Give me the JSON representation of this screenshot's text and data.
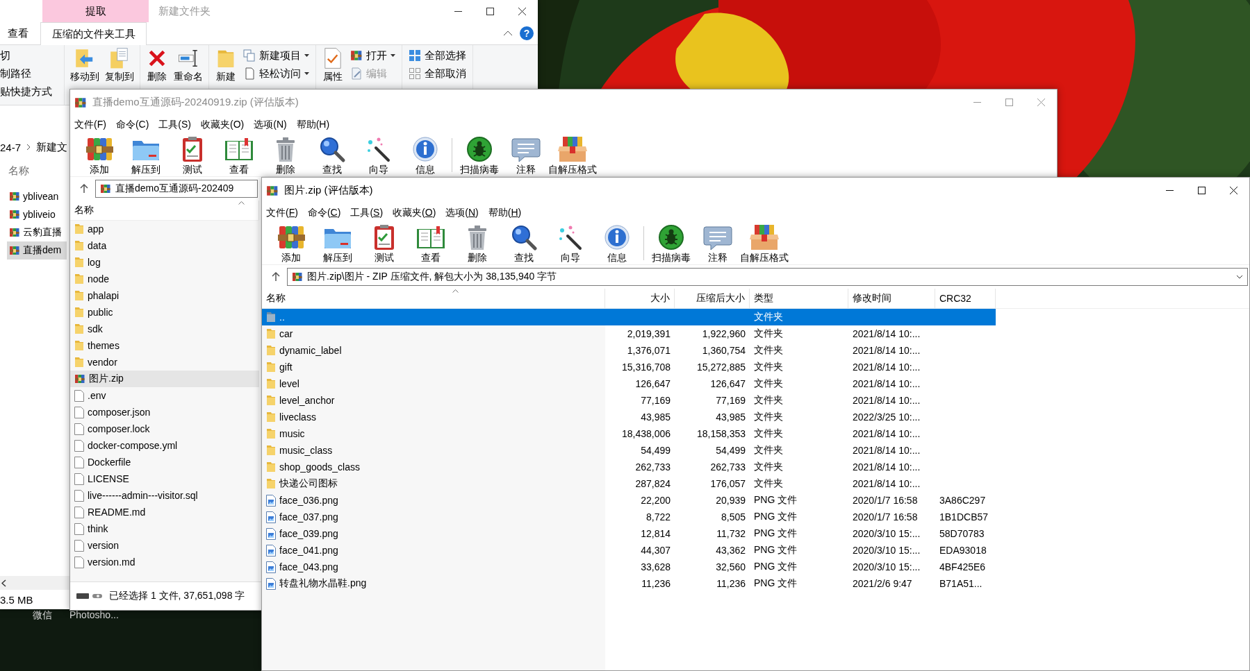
{
  "explorer": {
    "contextual_tab": "提取",
    "title": "新建文件夹",
    "tabs": [
      {
        "label": "查看",
        "selected": false
      },
      {
        "label": "压缩的文件夹工具",
        "selected": true
      }
    ],
    "help": "?",
    "ribbon_groups": [
      {
        "items": [
          {
            "kind": "text",
            "label": "切"
          },
          {
            "kind": "text",
            "label": "制路径"
          },
          {
            "kind": "text",
            "label": "贴快捷方式"
          }
        ]
      },
      {
        "items": [
          {
            "kind": "large",
            "label": "移动到"
          },
          {
            "kind": "large",
            "label": "复制到"
          }
        ]
      },
      {
        "items": [
          {
            "kind": "large",
            "label": "删除"
          },
          {
            "kind": "large",
            "label": "重命名"
          }
        ]
      },
      {
        "items": [
          {
            "kind": "large",
            "label": "新建"
          },
          {
            "kind": "small",
            "label": "新建项目",
            "dropdown": true,
            "disabled": false
          },
          {
            "kind": "small",
            "label": "轻松访问",
            "dropdown": true,
            "disabled": false
          }
        ]
      },
      {
        "items": [
          {
            "kind": "large",
            "label": "属性"
          },
          {
            "kind": "small",
            "label": "打开",
            "dropdown": true,
            "disabled": false
          },
          {
            "kind": "small",
            "label": "编辑",
            "dropdown": false,
            "disabled": true
          }
        ]
      },
      {
        "items": [
          {
            "kind": "small",
            "label": "全部选择",
            "dropdown": false,
            "disabled": false
          },
          {
            "kind": "small",
            "label": "全部取消",
            "dropdown": false,
            "disabled": false
          }
        ]
      }
    ],
    "breadcrumb": [
      "24-7",
      "新建文"
    ],
    "column": "名称",
    "items": [
      {
        "name": "yblivean",
        "selected": false
      },
      {
        "name": "ybliveio",
        "selected": false
      },
      {
        "name": "云豹直播",
        "selected": false
      },
      {
        "name": "直播dem",
        "selected": true
      }
    ],
    "status": "3.5 MB"
  },
  "desktop_labels": [
    "微信",
    "Photosho..."
  ],
  "archive_windows": [
    {
      "title": "直播demo互通源码-20240919.zip (评估版本)",
      "active": false,
      "menu": [
        "文件(F)",
        "命令(C)",
        "工具(S)",
        "收藏夹(O)",
        "选项(N)",
        "帮助(H)"
      ],
      "toolbar": [
        "添加",
        "解压到",
        "测试",
        "查看",
        "删除",
        "查找",
        "向导",
        "信息",
        "扫描病毒",
        "注释",
        "自解压格式"
      ],
      "address": "直播demo互通源码-202409",
      "columns": [
        "名称"
      ],
      "rows": [
        {
          "kind": "folder",
          "name": "app",
          "selected": false
        },
        {
          "kind": "folder",
          "name": "data",
          "selected": false
        },
        {
          "kind": "folder",
          "name": "log",
          "selected": false
        },
        {
          "kind": "folder",
          "name": "node",
          "selected": false
        },
        {
          "kind": "folder",
          "name": "phalapi",
          "selected": false
        },
        {
          "kind": "folder",
          "name": "public",
          "selected": false
        },
        {
          "kind": "folder",
          "name": "sdk",
          "selected": false
        },
        {
          "kind": "folder",
          "name": "themes",
          "selected": false
        },
        {
          "kind": "folder",
          "name": "vendor",
          "selected": false
        },
        {
          "kind": "zip",
          "name": "图片.zip",
          "selected": true
        },
        {
          "kind": "file",
          "name": ".env",
          "selected": false
        },
        {
          "kind": "file",
          "name": "composer.json",
          "selected": false
        },
        {
          "kind": "file",
          "name": "composer.lock",
          "selected": false
        },
        {
          "kind": "file",
          "name": "docker-compose.yml",
          "selected": false
        },
        {
          "kind": "file",
          "name": "Dockerfile",
          "selected": false
        },
        {
          "kind": "file",
          "name": "LICENSE",
          "selected": false
        },
        {
          "kind": "file",
          "name": "live------admin---visitor.sql",
          "selected": false
        },
        {
          "kind": "file",
          "name": "README.md",
          "selected": false
        },
        {
          "kind": "file",
          "name": "think",
          "selected": false
        },
        {
          "kind": "file",
          "name": "version",
          "selected": false
        },
        {
          "kind": "file",
          "name": "version.md",
          "selected": false
        }
      ],
      "status": "已经选择 1 文件, 37,651,098 字"
    },
    {
      "title": "图片.zip (评估版本)",
      "active": true,
      "menu": [
        "文件(F)",
        "命令(C)",
        "工具(S)",
        "收藏夹(O)",
        "选项(N)",
        "帮助(H)"
      ],
      "toolbar": [
        "添加",
        "解压到",
        "测试",
        "查看",
        "删除",
        "查找",
        "向导",
        "信息",
        "扫描病毒",
        "注释",
        "自解压格式"
      ],
      "address": "图片.zip\\图片 - ZIP 压缩文件, 解包大小为 38,135,940 字节",
      "columns": [
        "名称",
        "大小",
        "压缩后大小",
        "类型",
        "修改时间",
        "CRC32"
      ],
      "rows": [
        {
          "kind": "up",
          "name": "..",
          "type": "文件夹",
          "selected": true
        },
        {
          "kind": "folder",
          "name": "car",
          "size": "2,019,391",
          "packed": "1,922,960",
          "type": "文件夹",
          "modified": "2021/8/14 10:...",
          "selected": false
        },
        {
          "kind": "folder",
          "name": "dynamic_label",
          "size": "1,376,071",
          "packed": "1,360,754",
          "type": "文件夹",
          "modified": "2021/8/14 10:...",
          "selected": false
        },
        {
          "kind": "folder",
          "name": "gift",
          "size": "15,316,708",
          "packed": "15,272,885",
          "type": "文件夹",
          "modified": "2021/8/14 10:...",
          "selected": false
        },
        {
          "kind": "folder",
          "name": "level",
          "size": "126,647",
          "packed": "126,647",
          "type": "文件夹",
          "modified": "2021/8/14 10:...",
          "selected": false
        },
        {
          "kind": "folder",
          "name": "level_anchor",
          "size": "77,169",
          "packed": "77,169",
          "type": "文件夹",
          "modified": "2021/8/14 10:...",
          "selected": false
        },
        {
          "kind": "folder",
          "name": "liveclass",
          "size": "43,985",
          "packed": "43,985",
          "type": "文件夹",
          "modified": "2022/3/25 10:...",
          "selected": false
        },
        {
          "kind": "folder",
          "name": "music",
          "size": "18,438,006",
          "packed": "18,158,353",
          "type": "文件夹",
          "modified": "2021/8/14 10:...",
          "selected": false
        },
        {
          "kind": "folder",
          "name": "music_class",
          "size": "54,499",
          "packed": "54,499",
          "type": "文件夹",
          "modified": "2021/8/14 10:...",
          "selected": false
        },
        {
          "kind": "folder",
          "name": "shop_goods_class",
          "size": "262,733",
          "packed": "262,733",
          "type": "文件夹",
          "modified": "2021/8/14 10:...",
          "selected": false
        },
        {
          "kind": "folder",
          "name": "快递公司图标",
          "size": "287,824",
          "packed": "176,057",
          "type": "文件夹",
          "modified": "2021/8/14 10:...",
          "selected": false
        },
        {
          "kind": "png",
          "name": "face_036.png",
          "size": "22,200",
          "packed": "20,939",
          "type": "PNG 文件",
          "modified": "2020/1/7 16:58",
          "crc": "3A86C297",
          "selected": false
        },
        {
          "kind": "png",
          "name": "face_037.png",
          "size": "8,722",
          "packed": "8,505",
          "type": "PNG 文件",
          "modified": "2020/1/7 16:58",
          "crc": "1B1DCB57",
          "selected": false
        },
        {
          "kind": "png",
          "name": "face_039.png",
          "size": "12,814",
          "packed": "11,732",
          "type": "PNG 文件",
          "modified": "2020/3/10 15:...",
          "crc": "58D70783",
          "selected": false
        },
        {
          "kind": "png",
          "name": "face_041.png",
          "size": "44,307",
          "packed": "43,362",
          "type": "PNG 文件",
          "modified": "2020/3/10 15:...",
          "crc": "EDA93018",
          "selected": false
        },
        {
          "kind": "png",
          "name": "face_043.png",
          "size": "33,628",
          "packed": "32,560",
          "type": "PNG 文件",
          "modified": "2020/3/10 15:...",
          "crc": "4BF425E6",
          "selected": false
        },
        {
          "kind": "png",
          "name": "转盘礼物水晶鞋.png",
          "size": "11,236",
          "packed": "11,236",
          "type": "PNG 文件",
          "modified": "2021/2/6 9:47",
          "crc": "B71A51...",
          "selected": false
        }
      ]
    }
  ]
}
